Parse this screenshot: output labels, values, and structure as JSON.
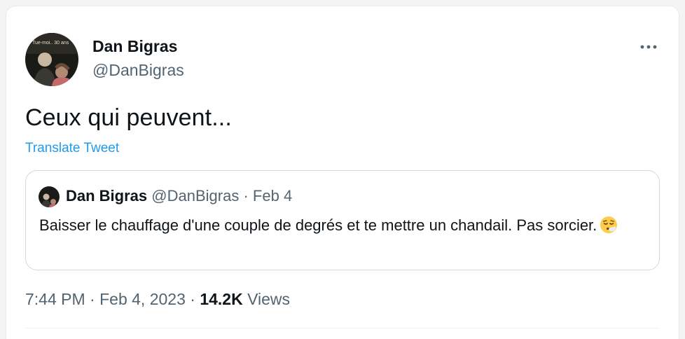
{
  "author": {
    "name": "Dan Bigras",
    "handle": "@DanBigras",
    "avatar_caption": "Tue-moi.. 30 ans"
  },
  "tweet": {
    "text": "Ceux qui peuvent...",
    "translate_label": "Translate Tweet"
  },
  "quoted": {
    "name": "Dan Bigras",
    "handle": "@DanBigras",
    "separator": "·",
    "date": "Feb 4",
    "text": "Baisser le chauffage d'une couple de degrés et te mettre un chandail. Pas sorcier.",
    "emoji": "face-exhaling-emoji"
  },
  "meta": {
    "time": "7:44 PM",
    "separator1": "·",
    "date": "Feb 4, 2023",
    "separator2": "·",
    "views_count": "14.2K",
    "views_label": "Views"
  },
  "icons": {
    "more": "more-dots-icon"
  },
  "colors": {
    "link": "#1d9bf0",
    "secondary_text": "#536471",
    "primary_text": "#0f1419",
    "border": "#cfd9de"
  }
}
